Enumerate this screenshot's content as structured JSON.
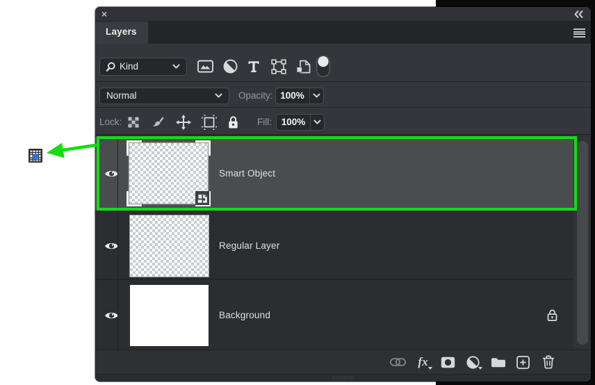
{
  "window": {
    "close_glyph": "×",
    "collapse_glyph": "«",
    "tab_title": "Layers"
  },
  "filter_bar": {
    "search_value": "Kind",
    "filter_icons": [
      "pixel-layer-filter",
      "adjustment-layer-filter",
      "type-layer-filter",
      "shape-layer-filter",
      "smart-object-filter"
    ],
    "toggle_icon": "layer-filter-toggle"
  },
  "blend_bar": {
    "mode_value": "Normal",
    "opacity_label": "Opacity:",
    "opacity_value": "100%"
  },
  "lock_bar": {
    "label": "Lock:",
    "fill_label": "Fill:",
    "fill_value": "100%"
  },
  "layers": [
    {
      "name": "Smart Object",
      "selected": true,
      "thumbnail": "transparent-checker",
      "badge": "smart-object-badge"
    },
    {
      "name": "Regular Layer",
      "selected": false,
      "thumbnail": "transparent-checker"
    },
    {
      "name": "Background",
      "selected": false,
      "thumbnail": "white",
      "locked": true
    }
  ],
  "footer": {
    "fx_label": "fx",
    "icons": [
      "link-layers",
      "layer-styles",
      "add-layer-mask",
      "new-adjustment-layer",
      "new-group",
      "new-layer",
      "delete-layer"
    ]
  },
  "annotation": {
    "highlight_color": "#12df12",
    "highlighted_layer": "Smart Object",
    "pointer_icon": "grid-favicon"
  }
}
